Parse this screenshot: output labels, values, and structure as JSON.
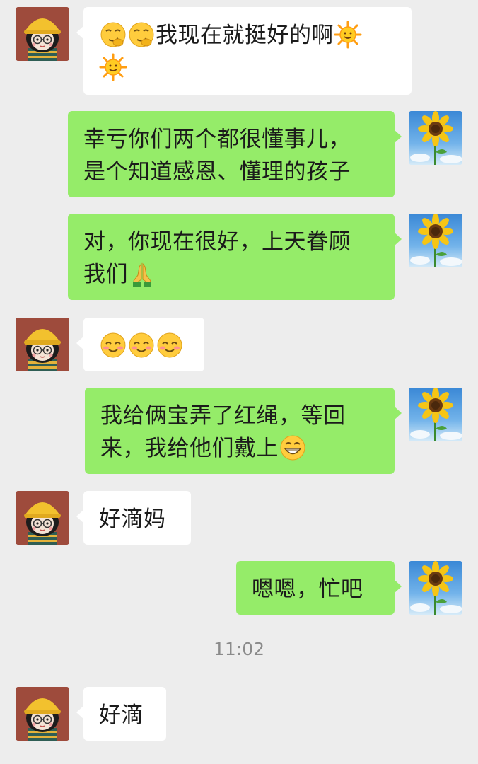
{
  "chat": {
    "messages": [
      {
        "sender": "other",
        "text": "我现在就挺好的啊"
      },
      {
        "sender": "me",
        "line1": "幸亏你们两个都很懂事儿，",
        "line2": "是个知道感恩、懂理的孩子"
      },
      {
        "sender": "me",
        "line1": "对，你现在很好，上天眷顾",
        "line2": "我们"
      },
      {
        "sender": "other",
        "emoji": "smile-emoji x3"
      },
      {
        "sender": "me",
        "line1": "我给俩宝弄了红绳，等回",
        "line2": "来，我给他们戴上"
      },
      {
        "sender": "other",
        "text": "好滴妈"
      },
      {
        "sender": "me",
        "text": "嗯嗯，忙吧"
      },
      {
        "sender": "other",
        "text": "好滴"
      }
    ],
    "timestamp": "11:02"
  },
  "colors": {
    "background": "#ededed",
    "my_bubble": "#95ec69",
    "their_bubble": "#ffffff",
    "timestamp_text": "#8b8b8b"
  },
  "avatars": {
    "other": "cartoon-girl-yellow-hat-avatar",
    "me": "sunflower-avatar"
  }
}
